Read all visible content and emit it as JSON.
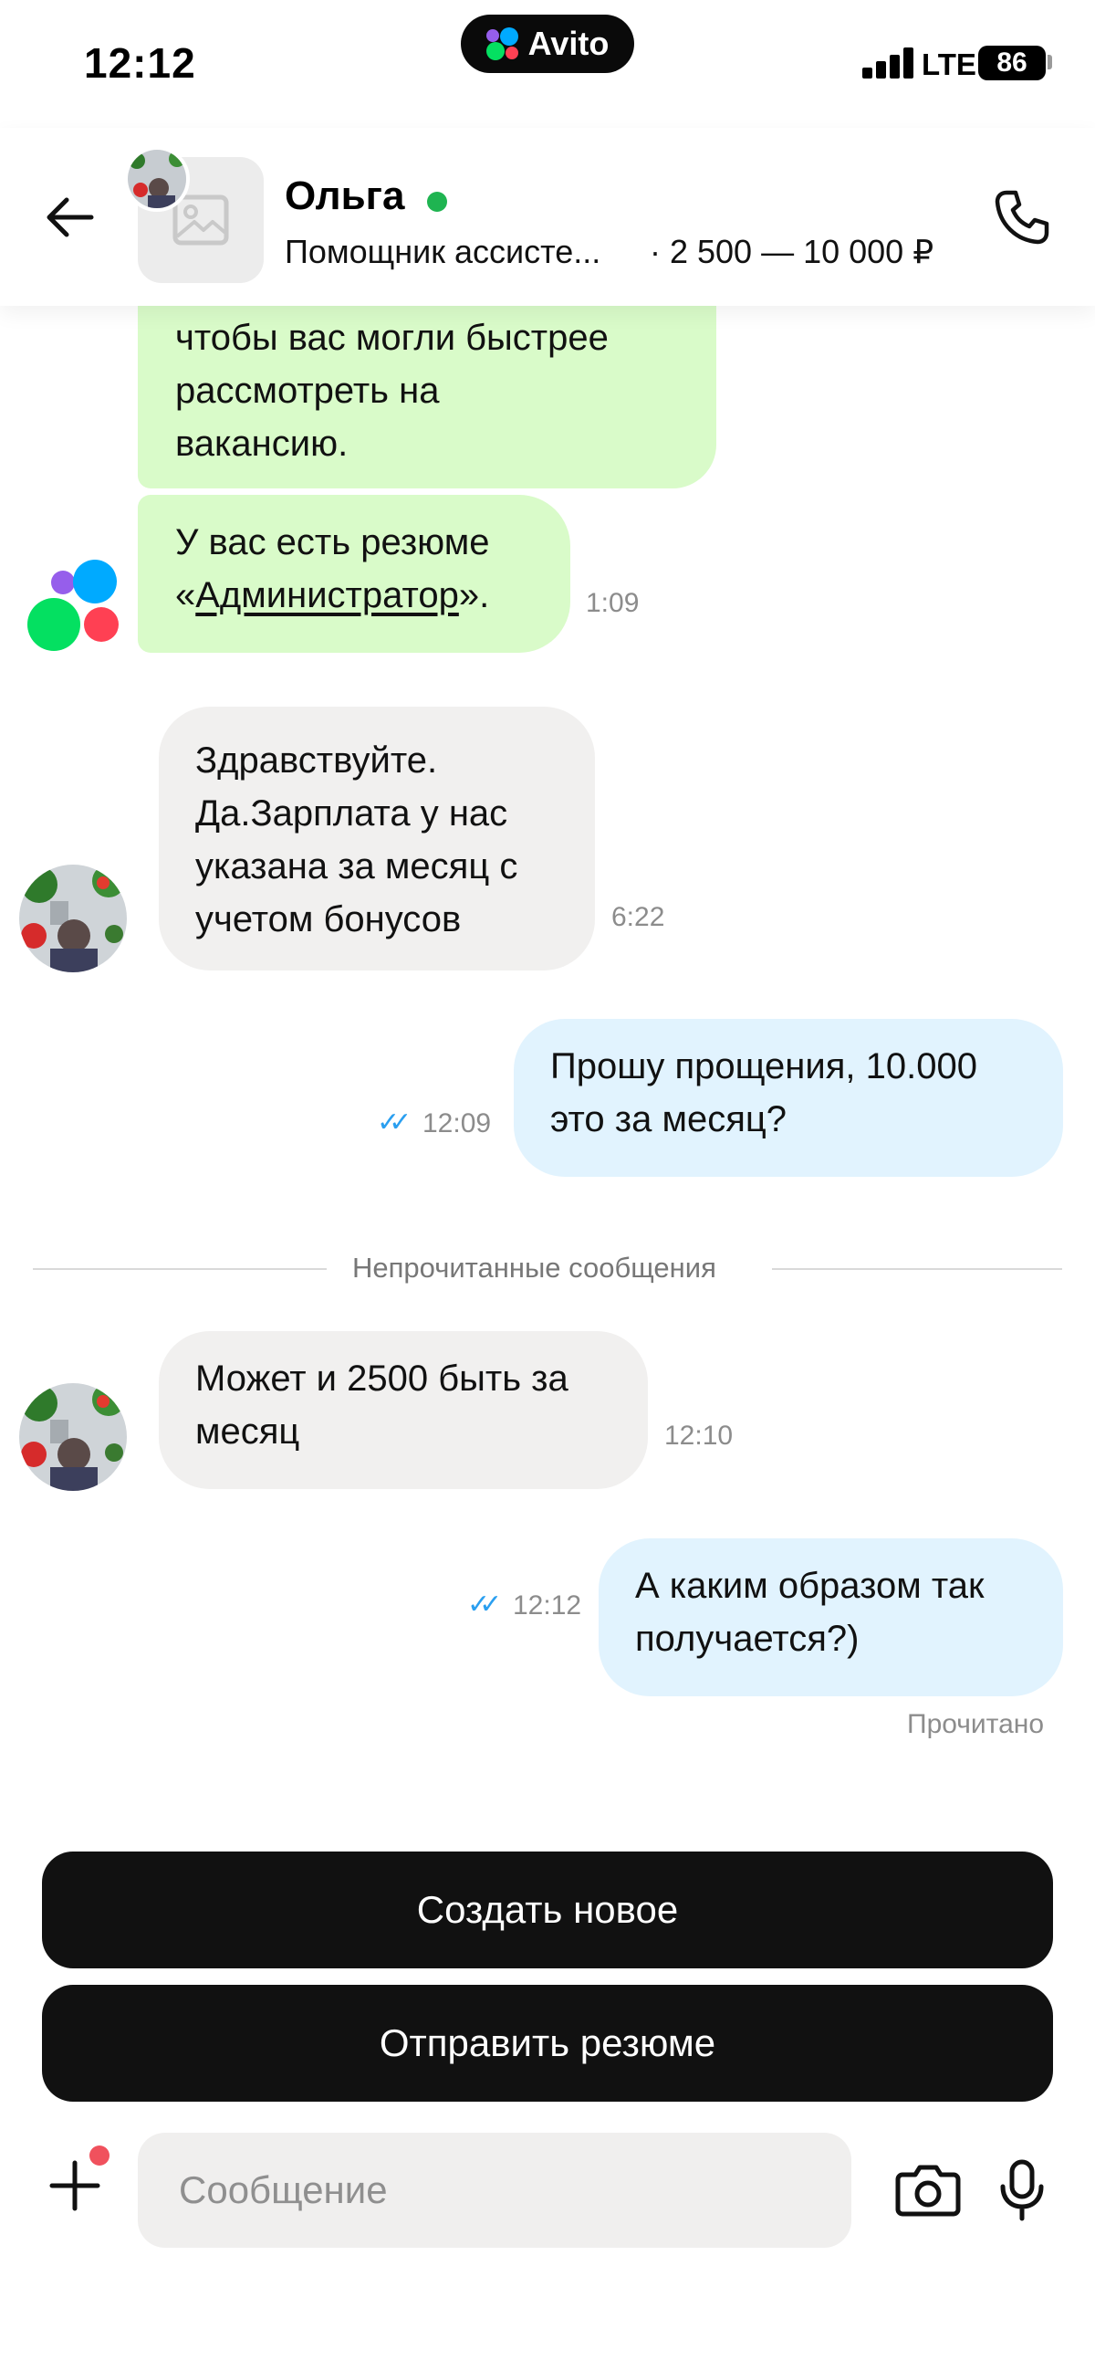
{
  "status_bar": {
    "time": "12:12",
    "app_badge": "Avito",
    "network": "LTE",
    "battery": "86"
  },
  "header": {
    "contact_name": "Ольга",
    "online": true,
    "listing_title": "Помощник ассисте...",
    "listing_price": "· 2 500 — 10 000 ₽",
    "icons": {
      "back": "arrow-left-icon",
      "call": "phone-icon",
      "thumb": "image-placeholder-icon"
    }
  },
  "messages": [
    {
      "from": "bot",
      "lines": [
        "чтобы вас могли быстрее",
        "рассмотреть на",
        "вакансию."
      ]
    },
    {
      "from": "bot",
      "prefix": "У вас есть резюме",
      "open_quote": "«",
      "link": "Администратор",
      "close_quote": "».",
      "time": "1:09"
    },
    {
      "from": "contact",
      "lines": [
        "Здравствуйте.",
        "Да.Зарплата у нас",
        "указана за месяц с",
        "учетом бонусов"
      ],
      "time": "6:22"
    },
    {
      "from": "me",
      "lines": [
        "Прошу прощения, 10.000",
        "это за месяц?"
      ],
      "time": "12:09",
      "ticks": "✓✓"
    },
    {
      "from": "contact",
      "lines": [
        "Может и 2500 быть за",
        "месяц"
      ],
      "time": "12:10"
    },
    {
      "from": "me",
      "lines": [
        "А каким образом так",
        "получается?)"
      ],
      "time": "12:12",
      "ticks": "✓✓"
    }
  ],
  "unread_divider": "Непрочитанные сообщения",
  "read_status": "Прочитано",
  "actions": {
    "create_new": "Создать новое",
    "send_resume": "Отправить резюме"
  },
  "composer": {
    "placeholder": "Сообщение",
    "value": "",
    "icons": {
      "attach": "plus-icon",
      "camera": "camera-icon",
      "mic": "microphone-icon"
    }
  },
  "colors": {
    "bot_bubble": "#d9fbc9",
    "incoming_bubble": "#f1f0ef",
    "outgoing_bubble": "#e1f3fe",
    "online": "#1fb451",
    "read_ticks": "#2a9ff0",
    "button_bg": "#111111",
    "notification_dot": "#f0515d"
  }
}
